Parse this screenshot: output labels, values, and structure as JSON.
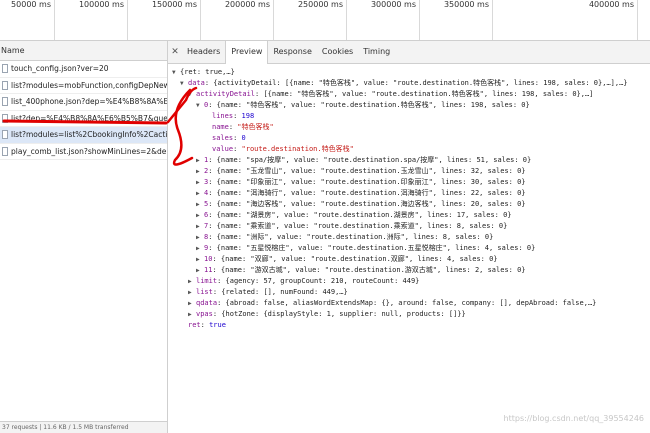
{
  "timeline": {
    "ticks": [
      "50000 ms",
      "100000 ms",
      "150000 ms",
      "200000 ms",
      "250000 ms",
      "300000 ms",
      "350000 ms",
      "400000 ms"
    ]
  },
  "name_panel": {
    "header": "Name",
    "rows": [
      "touch_config.json?ver=20",
      "list?modules=mobFunction,configDepNew...",
      "list_400phone.json?dep=%E4%B8%8A%E6%...",
      "list?dep=%E4%B8%8A%E6%B5%B7&query...",
      "list?modules=list%2CbookingInfo%2Cactivi...",
      "play_comb_list.json?showMinLines=2&dep=..."
    ],
    "status": "37 requests | 11.6 KB / 1.5 MB transferred"
  },
  "tabs": [
    "Headers",
    "Preview",
    "Response",
    "Cookies",
    "Timing"
  ],
  "active_tab": "Preview",
  "tree": {
    "root": "{ret: true,…}",
    "data_key": "data",
    "data_preview": "{activityDetail: [{name: \"特色客栈\", value: \"route.destination.特色客栈\", lines: 198, sales: 0},…],…}",
    "activity_key": "activityDetail",
    "activity_preview": "[{name: \"特色客栈\", value: \"route.destination.特色客栈\", lines: 198, sales: 0},…]",
    "item0_key": "0",
    "item0_preview": "{name: \"特色客栈\", value: \"route.destination.特色客栈\", lines: 198, sales: 0}",
    "item0_fields": [
      {
        "key": "lines",
        "value": "198",
        "type": "n"
      },
      {
        "key": "name",
        "value": "\"特色客栈\"",
        "type": "s"
      },
      {
        "key": "sales",
        "value": "0",
        "type": "n"
      },
      {
        "key": "value",
        "value": "\"route.destination.特色客栈\"",
        "type": "s"
      }
    ],
    "items": [
      {
        "key": "1",
        "preview": "{name: \"spa/按摩\", value: \"route.destination.spa/按摩\", lines: 51, sales: 0}"
      },
      {
        "key": "2",
        "preview": "{name: \"玉龙雪山\", value: \"route.destination.玉龙雪山\", lines: 32, sales: 0}"
      },
      {
        "key": "3",
        "preview": "{name: \"印象丽江\", value: \"route.destination.印象丽江\", lines: 30, sales: 0}"
      },
      {
        "key": "4",
        "preview": "{name: \"洱海骑行\", value: \"route.destination.洱海骑行\", lines: 22, sales: 0}"
      },
      {
        "key": "5",
        "preview": "{name: \"海边客栈\", value: \"route.destination.海边客栈\", lines: 20, sales: 0}"
      },
      {
        "key": "6",
        "preview": "{name: \"湖景房\", value: \"route.destination.湖景房\", lines: 17, sales: 0}"
      },
      {
        "key": "7",
        "preview": "{name: \"乘索道\", value: \"route.destination.乘索道\", lines: 8, sales: 0}"
      },
      {
        "key": "8",
        "preview": "{name: \"洲际\", value: \"route.destination.洲际\", lines: 8, sales: 0}"
      },
      {
        "key": "9",
        "preview": "{name: \"五星悦榕庄\", value: \"route.destination.五星悦榕庄\", lines: 4, sales: 0}"
      },
      {
        "key": "10",
        "preview": "{name: \"双廊\", value: \"route.destination.双廊\", lines: 4, sales: 0}"
      },
      {
        "key": "11",
        "preview": "{name: \"游双古城\", value: \"route.destination.游双古城\", lines: 2, sales: 0}"
      }
    ],
    "siblings": [
      {
        "key": "limit",
        "preview": "{agency: 57, groupCount: 210, routeCount: 449}"
      },
      {
        "key": "list",
        "preview": "{related: [], numFound: 449,…}"
      },
      {
        "key": "qdata",
        "preview": "{abroad: false, aliasWordExtendsMap: {}, around: false, company: [], depAbroad: false,…}"
      },
      {
        "key": "vpas",
        "preview": "{hotZone: {displayStyle: 1, supplier: null, products: []}}"
      }
    ],
    "ret_key": "ret",
    "ret_value": "true"
  },
  "watermark": "https://blog.csdn.net/qq_39554246",
  "colors": {
    "annotation": "#e00000",
    "selected_row": "#dce7f7"
  }
}
